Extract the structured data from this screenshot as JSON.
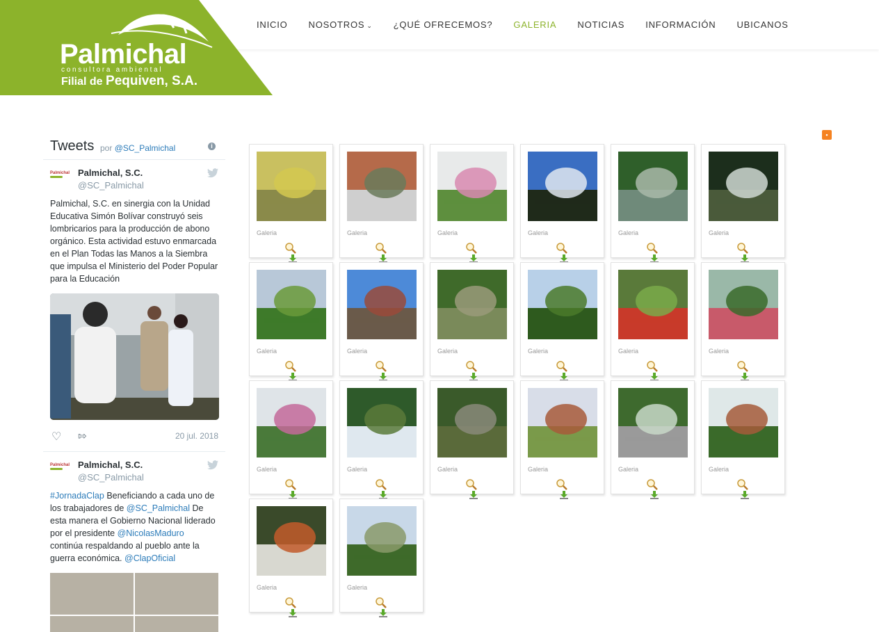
{
  "brand": {
    "name": "Palmichal",
    "tagline": "consultora ambiental",
    "filial_prefix": "Filial de",
    "filial_name": "Pequiven, S.A.",
    "color": "#8cb32b"
  },
  "nav": {
    "items": [
      {
        "label": "INICIO"
      },
      {
        "label": "NOSOTROS"
      },
      {
        "label": "¿QUÉ OFRECEMOS?"
      },
      {
        "label": "GALERIA",
        "active": true
      },
      {
        "label": "NOTICIAS"
      },
      {
        "label": "INFORMACIÓN"
      },
      {
        "label": "UBICANOS"
      }
    ]
  },
  "twitter": {
    "title": "Tweets",
    "by": "por",
    "handle": "@SC_Palmichal",
    "tweets": [
      {
        "name": "Palmichal, S.C.",
        "handle": "@SC_Palmichal",
        "text": "Palmichal, S.C. en sinergia con la Unidad Educativa Simón Bolívar construyó seis lombricarios para la producción de abono orgánico. Esta actividad estuvo enmarcada en el Plan Todas las Manos a la Siembra que impulsa el Ministerio del Poder Popular para la Educación",
        "date": "20 jul. 2018"
      },
      {
        "name": "Palmichal, S.C.",
        "handle": "@SC_Palmichal",
        "text_parts": [
          "#JornadaClap",
          " Beneficiando a cada uno de los trabajadores de ",
          "@SC_Palmichal",
          " De esta manera el Gobierno Nacional liderado por el presidente ",
          "@NicolasMaduro",
          " continúa respaldando al pueblo ante la guerra económica. ",
          "@ClapOficial"
        ]
      }
    ]
  },
  "gallery": {
    "caption": "Galeria",
    "items": [
      {
        "c1": "#c9c060",
        "c2": "#8a8a4a",
        "c3": "#d4c850"
      },
      {
        "c1": "#b56a4a",
        "c2": "#cfcfcf",
        "c3": "#6a7a5a"
      },
      {
        "c1": "#e8eaea",
        "c2": "#5e8f3e",
        "c3": "#d889b0"
      },
      {
        "c1": "#3a6ec2",
        "c2": "#1f2a1a",
        "c3": "#e0e8f0"
      },
      {
        "c1": "#2f5f2a",
        "c2": "#6f8a7a",
        "c3": "#a9b9a9"
      },
      {
        "c1": "#1c2e1c",
        "c2": "#4a5a3a",
        "c3": "#cfd8d2"
      },
      {
        "c1": "#b8c8d8",
        "c2": "#3e7a2a",
        "c3": "#6a9a3a"
      },
      {
        "c1": "#4d8ad8",
        "c2": "#6a5a4a",
        "c3": "#9a4a3a"
      },
      {
        "c1": "#3f6a2a",
        "c2": "#7a8a5a",
        "c3": "#9a9a7a"
      },
      {
        "c1": "#b8d0e8",
        "c2": "#2e5a1e",
        "c3": "#4a7a2a"
      },
      {
        "c1": "#5a7a3a",
        "c2": "#c83a2a",
        "c3": "#7aaa4a"
      },
      {
        "c1": "#9ab8a8",
        "c2": "#c85a6a",
        "c3": "#3a6a2a"
      },
      {
        "c1": "#dfe4e8",
        "c2": "#4a7a3a",
        "c3": "#c46a9a"
      },
      {
        "c1": "#2e5a2a",
        "c2": "#dfe8ef",
        "c3": "#5a7a3a"
      },
      {
        "c1": "#3a5a2a",
        "c2": "#5a6a3a",
        "c3": "#8a8a7a"
      },
      {
        "c1": "#d8dde8",
        "c2": "#7a9a4a",
        "c3": "#a85a3a"
      },
      {
        "c1": "#3e6a2e",
        "c2": "#9a9a9a",
        "c3": "#c8d8c8"
      },
      {
        "c1": "#dfe8e8",
        "c2": "#3a6a2a",
        "c3": "#a65a3a"
      },
      {
        "c1": "#3a4a2a",
        "c2": "#d8d8d0",
        "c3": "#c25a2a"
      },
      {
        "c1": "#c8d8e8",
        "c2": "#3e6a2a",
        "c3": "#8a9a6a"
      }
    ]
  }
}
